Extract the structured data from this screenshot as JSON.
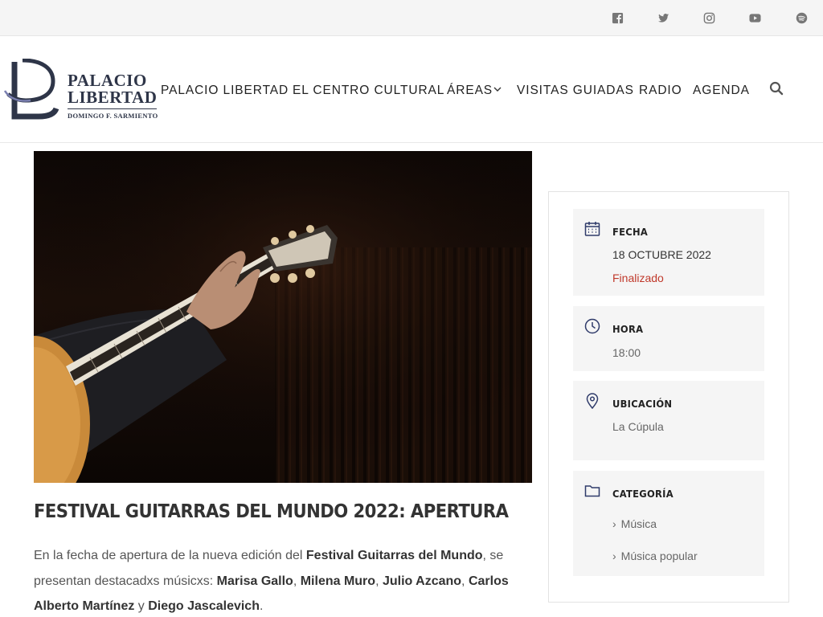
{
  "topbar": {
    "social": [
      {
        "name": "facebook-icon"
      },
      {
        "name": "twitter-icon"
      },
      {
        "name": "instagram-icon"
      },
      {
        "name": "youtube-icon"
      },
      {
        "name": "spotify-icon"
      }
    ]
  },
  "logo": {
    "line1": "PALACIO",
    "line2": "LIBERTAD",
    "line3": "DOMINGO F. SARMIENTO"
  },
  "nav": {
    "items": [
      {
        "label": "PALACIO LIBERTAD"
      },
      {
        "label": "EL CENTRO CULTURAL"
      },
      {
        "label": "ÁREAS"
      },
      {
        "label": "VISITAS GUIADAS"
      },
      {
        "label": "RADIO"
      },
      {
        "label": "AGENDA"
      }
    ]
  },
  "article": {
    "title": "FESTIVAL GUITARRAS DEL MUNDO 2022: APERTURA",
    "intro": "En la fecha de apertura de la nueva edición del ",
    "festival": "Festival Guitarras del Mundo",
    "mid": ", se presentan destacadxs músicxs: ",
    "artists": [
      "Marisa Gallo",
      "Milena Muro",
      "Julio Azcano",
      "Carlos Alberto Martínez",
      "Diego Jascalevich"
    ],
    "sep1": ", ",
    "sep_and": " y ",
    "end": "."
  },
  "sidebar": {
    "fecha": {
      "label": "FECHA",
      "value": "18 OCTUBRE 2022",
      "status": "Finalizado"
    },
    "hora": {
      "label": "HORA",
      "value": "18:00"
    },
    "ubicacion": {
      "label": "UBICACIÓN",
      "value": "La Cúpula"
    },
    "categoria": {
      "label": "CATEGORÍA",
      "items": [
        "Música",
        "Música popular"
      ]
    }
  },
  "colors": {
    "accent": "#2f3b6a",
    "status_red": "#c0392b",
    "brand": "#2e3548"
  }
}
